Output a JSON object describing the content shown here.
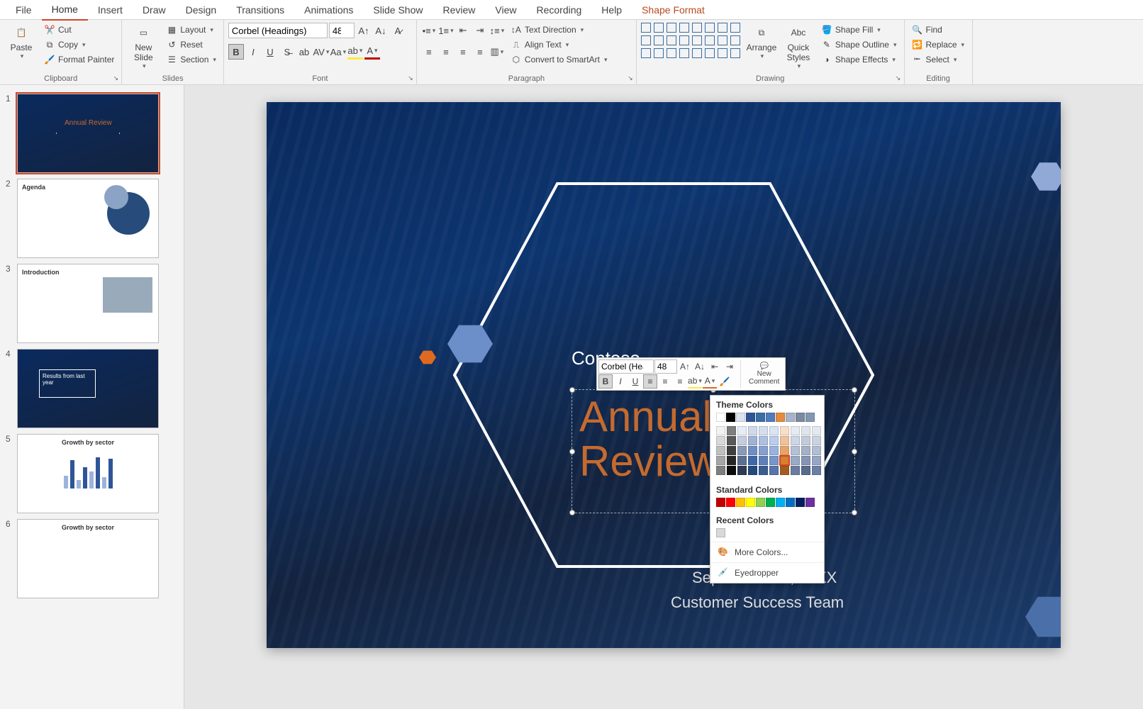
{
  "tabs": {
    "file": "File",
    "home": "Home",
    "insert": "Insert",
    "draw": "Draw",
    "design": "Design",
    "transitions": "Transitions",
    "animations": "Animations",
    "slideshow": "Slide Show",
    "review": "Review",
    "view": "View",
    "recording": "Recording",
    "help": "Help",
    "shapeFormat": "Shape Format"
  },
  "ribbon": {
    "clipboard": {
      "label": "Clipboard",
      "paste": "Paste",
      "cut": "Cut",
      "copy": "Copy",
      "formatPainter": "Format Painter"
    },
    "slides": {
      "label": "Slides",
      "newSlide": "New\nSlide",
      "layout": "Layout",
      "reset": "Reset",
      "section": "Section"
    },
    "font": {
      "label": "Font",
      "name": "Corbel (Headings)",
      "size": "48"
    },
    "paragraph": {
      "label": "Paragraph",
      "textDirection": "Text Direction",
      "alignText": "Align Text",
      "smartArt": "Convert to SmartArt"
    },
    "drawing": {
      "label": "Drawing",
      "arrange": "Arrange",
      "quickStyles": "Quick\nStyles",
      "shapeFill": "Shape Fill",
      "shapeOutline": "Shape Outline",
      "shapeEffects": "Shape Effects"
    },
    "editing": {
      "label": "Editing",
      "find": "Find",
      "replace": "Replace",
      "select": "Select"
    }
  },
  "slide": {
    "company": "Contoso",
    "title": "Annual Review",
    "date": "September 10, 20XX",
    "team": "Customer Success Team"
  },
  "thumbs": [
    {
      "n": "1",
      "title": "Annual Review"
    },
    {
      "n": "2",
      "title": "Agenda"
    },
    {
      "n": "3",
      "title": "Introduction"
    },
    {
      "n": "4",
      "title": "Results from last year"
    },
    {
      "n": "5",
      "title": "Growth by sector"
    },
    {
      "n": "6",
      "title": "Growth by sector"
    }
  ],
  "miniToolbar": {
    "font": "Corbel (Headin",
    "size": "48",
    "newComment": "New",
    "newComment2": "Comment"
  },
  "colorPicker": {
    "theme": "Theme Colors",
    "standard": "Standard Colors",
    "recent": "Recent Colors",
    "more": "More Colors...",
    "eyedropper": "Eyedropper",
    "themeRow": [
      "#ffffff",
      "#000000",
      "#dbe2ed",
      "#2f5597",
      "#3a6ea5",
      "#4f7bbf",
      "#e38b3e",
      "#a6b3c8",
      "#7b8aa0",
      "#8497b0"
    ],
    "tints": [
      [
        "#f2f2f2",
        "#7f7f7f",
        "#e8ecf4",
        "#cfd9eb",
        "#d5deee",
        "#dbe4f2",
        "#f7e0cb",
        "#e6ebf2",
        "#e0e5ec",
        "#e4e9f0"
      ],
      [
        "#d8d8d8",
        "#595959",
        "#c5cede",
        "#a0b3d6",
        "#adc0e0",
        "#bacded",
        "#f0c29a",
        "#cdd6e4",
        "#c2cbd9",
        "#cad3e1"
      ],
      [
        "#bfbfbf",
        "#3f3f3f",
        "#8a9ab6",
        "#6f8ec5",
        "#86a0cf",
        "#99b2de",
        "#e8a468",
        "#b4c0d5",
        "#a4b1c6",
        "#b0bdd2"
      ],
      [
        "#a5a5a5",
        "#262626",
        "#5d6f8e",
        "#3e67a8",
        "#5e80b9",
        "#7896ca",
        "#d97f2d",
        "#9ba9c6",
        "#8695b3",
        "#96a6c3"
      ],
      [
        "#7f7f7f",
        "#0c0c0c",
        "#2e3b52",
        "#234a7d",
        "#395e91",
        "#5776a9",
        "#a45c1f",
        "#6b7ca1",
        "#586a8e",
        "#6c7fa6"
      ]
    ],
    "standardRow": [
      "#c00000",
      "#ff0000",
      "#ffc000",
      "#ffff00",
      "#92d050",
      "#00b050",
      "#00b0f0",
      "#0070c0",
      "#002060",
      "#7030a0"
    ],
    "recentRow": [
      "#d9d9d9"
    ],
    "selected": "#d97f2d"
  }
}
